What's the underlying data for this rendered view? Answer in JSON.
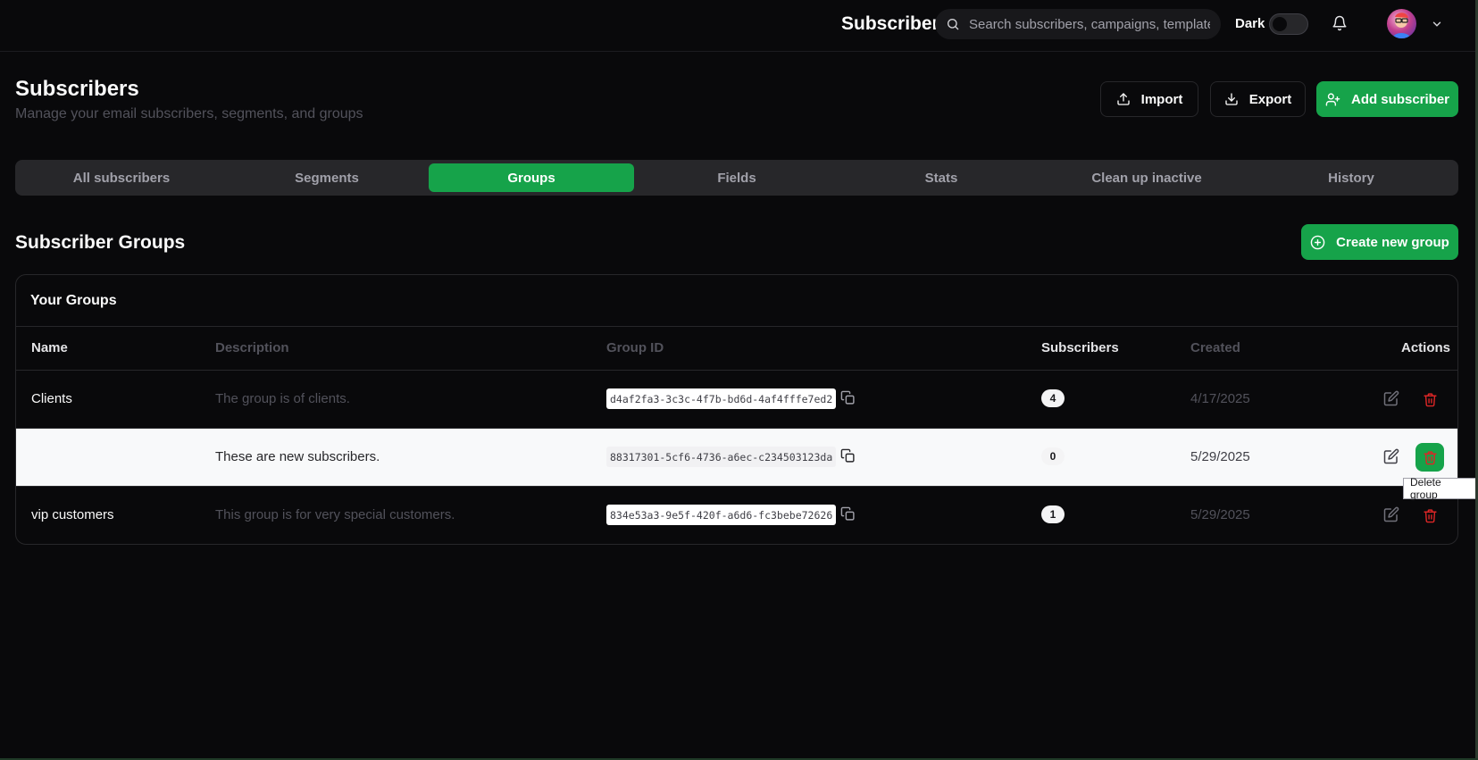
{
  "topbar": {
    "title": "Subscribers",
    "search_placeholder": "Search subscribers, campaigns, templates...",
    "theme_label": "Dark"
  },
  "header": {
    "title": "Subscribers",
    "subtitle": "Manage your email subscribers, segments, and groups",
    "import_label": "Import",
    "export_label": "Export",
    "add_label": "Add subscriber"
  },
  "tabs": [
    {
      "label": "All subscribers"
    },
    {
      "label": "Segments"
    },
    {
      "label": "Groups",
      "active": true
    },
    {
      "label": "Fields"
    },
    {
      "label": "Stats"
    },
    {
      "label": "Clean up inactive"
    },
    {
      "label": "History"
    }
  ],
  "section": {
    "title": "Subscriber Groups",
    "create_label": "Create new group",
    "card_title": "Your Groups"
  },
  "table": {
    "columns": {
      "name": "Name",
      "description": "Description",
      "group_id": "Group ID",
      "subscribers": "Subscribers",
      "created": "Created",
      "actions": "Actions"
    },
    "rows": [
      {
        "name": "Clients",
        "description": "The group is of clients.",
        "group_id": "d4af2fa3-3c3c-4f7b-bd6d-4af4fffe7ed2",
        "subscribers": "4",
        "created": "4/17/2025"
      },
      {
        "name": "",
        "description": "These are new subscribers.",
        "group_id": "88317301-5cf6-4736-a6ec-c234503123da",
        "subscribers": "0",
        "created": "5/29/2025"
      },
      {
        "name": "vip customers",
        "description": "This group is for very special customers.",
        "group_id": "834e53a3-9e5f-420f-a6d6-fc3bebe72626",
        "subscribers": "1",
        "created": "5/29/2025"
      }
    ]
  },
  "tooltip": "Delete group",
  "colors": {
    "background": "#09090b",
    "accent": "#16a34a",
    "danger": "#dc2626",
    "muted": "#52525b"
  }
}
